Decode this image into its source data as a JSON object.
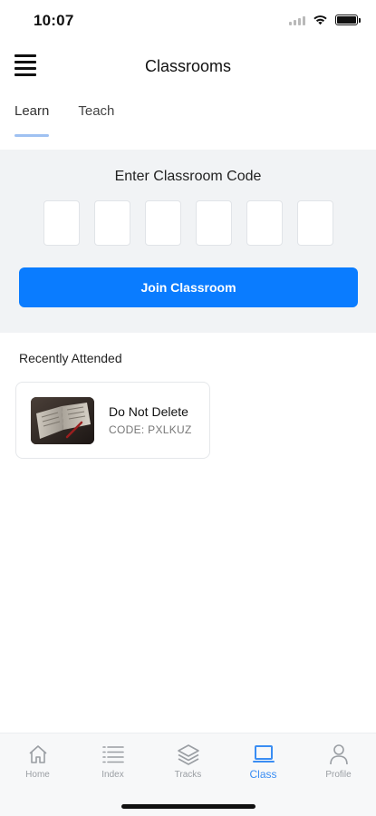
{
  "status_bar": {
    "time": "10:07"
  },
  "header": {
    "title": "Classrooms"
  },
  "tabs": [
    {
      "label": "Learn",
      "active": true
    },
    {
      "label": "Teach",
      "active": false
    }
  ],
  "code_panel": {
    "title": "Enter Classroom Code",
    "boxes": [
      "",
      "",
      "",
      "",
      "",
      ""
    ],
    "join_label": "Join Classroom"
  },
  "recent": {
    "title": "Recently Attended",
    "items": [
      {
        "name": "Do Not Delete",
        "code": "CODE: PXLKUZ"
      }
    ]
  },
  "bottom_nav": {
    "items": [
      {
        "label": "Home",
        "icon": "home-icon",
        "active": false
      },
      {
        "label": "Index",
        "icon": "list-icon",
        "active": false
      },
      {
        "label": "Tracks",
        "icon": "layers-icon",
        "active": false
      },
      {
        "label": "Class",
        "icon": "classroom-icon",
        "active": true
      },
      {
        "label": "Profile",
        "icon": "person-icon",
        "active": false
      }
    ]
  },
  "colors": {
    "accent": "#0a7cff",
    "tab_indicator": "#9fc1f2",
    "panel_bg": "#f1f3f5",
    "nav_active": "#3a8df3",
    "nav_inactive": "#9a9ea3"
  }
}
